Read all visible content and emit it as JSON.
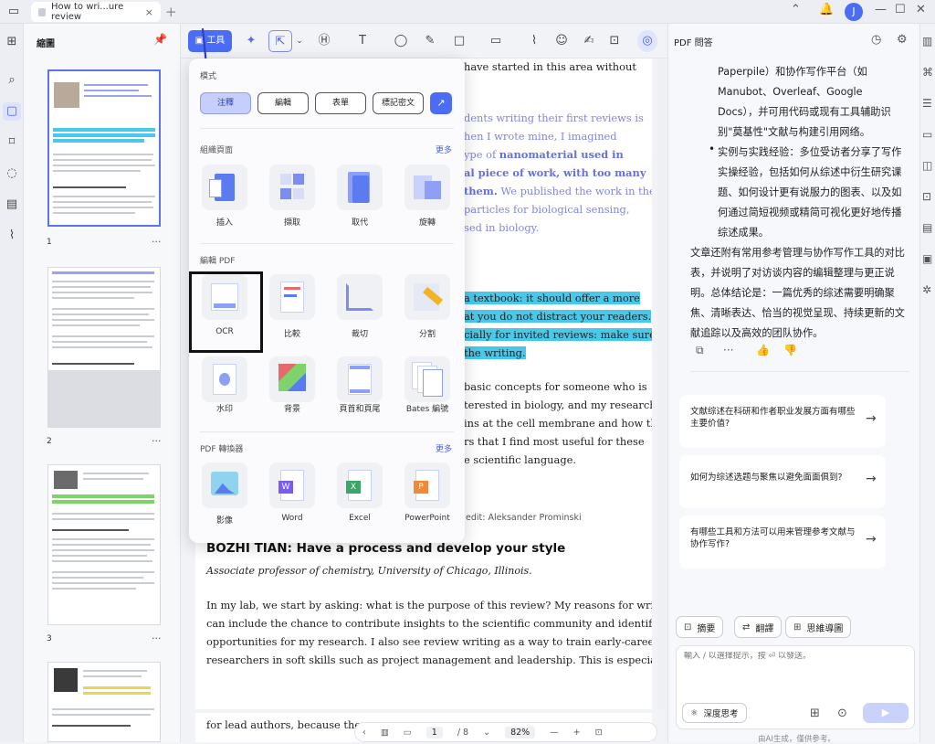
{
  "tab": {
    "title": "How to wri...ure review",
    "close": "×"
  },
  "topbar": {
    "plus": "+",
    "avatar": "J"
  },
  "thumbs": {
    "title": "縮圖",
    "pages": [
      {
        "label": "1",
        "more": "···"
      },
      {
        "label": "2",
        "more": "···"
      },
      {
        "label": "3",
        "more": "···"
      }
    ]
  },
  "toolbar": {
    "tools_label": "工具"
  },
  "menu": {
    "mode_label": "模式",
    "modes": [
      "注釋",
      "編輯",
      "表單",
      "標記密文"
    ],
    "organize_label": "組織頁面",
    "organize_more": "更多",
    "organize": [
      "插入",
      "擷取",
      "取代",
      "旋轉"
    ],
    "edit_label": "編輯 PDF",
    "edit": [
      "OCR",
      "比較",
      "裁切",
      "分割",
      "水印",
      "背景",
      "頁首和頁尾",
      "Bates 編號"
    ],
    "convert_label": "PDF 轉換器",
    "convert_more": "更多",
    "convert": [
      "影像",
      "Word",
      "Excel",
      "PowerPoint"
    ]
  },
  "doc": {
    "lines": [
      "have started in this area without",
      "dents writing their first reviews is",
      "hen I wrote mine, I imagined",
      "ype of",
      "nanomaterial used in",
      "al piece of work, with too many",
      "them.",
      " We  published the work in the",
      "particles for biological sensing,",
      "sed in biology.",
      "a textbook: it should offer a more",
      "at you do not distract your readers.",
      "cially for invited reviews: make sure",
      "the writing.",
      "basic concepts for someone who is",
      "terested in biology, and my research",
      "ins at the cell membrane and how this",
      "rs that I find most useful for these",
      "e scientific language.",
      "edit: Aleksander Prominski",
      "BOZHI TIAN: Have a process and develop your style",
      "Associate professor of chemistry, University of Chicago, Illinois.",
      "In my lab, we start by asking: what is the purpose of this review? My reasons for writing one",
      "can include the chance to contribute insights to the scientific community and identify",
      "opportunities for my research. I also see review writing as a way to train early-career",
      "researchers in soft skills such as project management and leadership. This is especially true",
      "for lead authors, because they w"
    ]
  },
  "navbar": {
    "page": "1",
    "total": "/ 8",
    "zoom": "82%",
    "minus": "—",
    "plus": "+"
  },
  "right": {
    "title": "PDF 問答",
    "answer": [
      "Paperpile）和协作写作平台（如",
      "Manubot、Overleaf、Google",
      "Docs），并可用代码或现有工具辅助识",
      "别\"莫基性\"文献与构建引用网络。",
      "实例与实践经验：多位受访者分享了写作",
      "实操经验，包括如何从综述中衍生研究课",
      "题、如何设计更有说服力的图表、以及如",
      "何通过简短视频或精简可视化更好地传播",
      "综述成果。",
      "文章还附有常用参考管理与协作写作工具的对比",
      "表，并说明了对访谈内容的编辑整理与更正说",
      "明。总体结论是：一篇优秀的综述需要明确聚",
      "焦、清晰表达、恰当的视觉呈现、持续更新的文",
      "献追踪以及高效的团队协作。"
    ],
    "suggestions": [
      "文献综述在科研和作者职业发展方面有哪些主要价值?",
      "如何为综述选题与聚焦以避免面面俱到?",
      "有哪些工具和方法可以用来管理参考文献与协作写作?"
    ],
    "chips": [
      "摘要",
      "翻譯",
      "思維導圖"
    ],
    "input_placeholder": "輸入 / 以選擇提示，按 ⏎ 以發送。",
    "deep_think": "深度思考",
    "footer": "由AI生成，僅供參考。"
  }
}
